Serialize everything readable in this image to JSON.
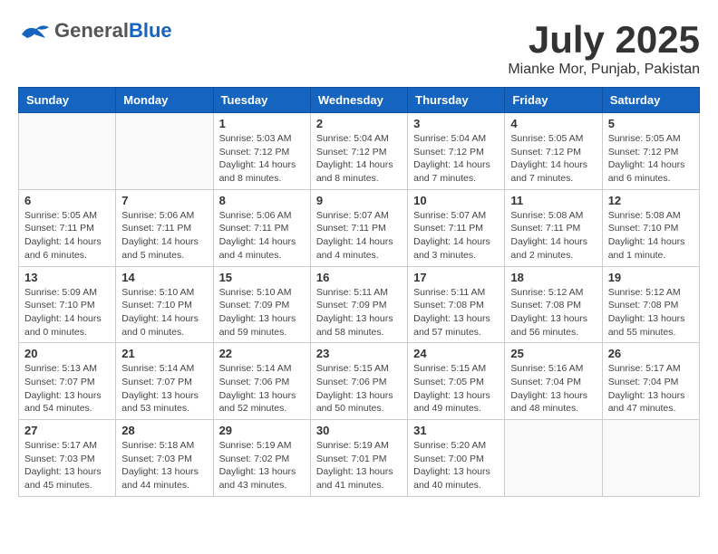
{
  "header": {
    "logo_general": "General",
    "logo_blue": "Blue",
    "month_title": "July 2025",
    "subtitle": "Mianke Mor, Punjab, Pakistan"
  },
  "weekdays": [
    "Sunday",
    "Monday",
    "Tuesday",
    "Wednesday",
    "Thursday",
    "Friday",
    "Saturday"
  ],
  "weeks": [
    [
      {
        "day": "",
        "info": ""
      },
      {
        "day": "",
        "info": ""
      },
      {
        "day": "1",
        "info": "Sunrise: 5:03 AM\nSunset: 7:12 PM\nDaylight: 14 hours and 8 minutes."
      },
      {
        "day": "2",
        "info": "Sunrise: 5:04 AM\nSunset: 7:12 PM\nDaylight: 14 hours and 8 minutes."
      },
      {
        "day": "3",
        "info": "Sunrise: 5:04 AM\nSunset: 7:12 PM\nDaylight: 14 hours and 7 minutes."
      },
      {
        "day": "4",
        "info": "Sunrise: 5:05 AM\nSunset: 7:12 PM\nDaylight: 14 hours and 7 minutes."
      },
      {
        "day": "5",
        "info": "Sunrise: 5:05 AM\nSunset: 7:12 PM\nDaylight: 14 hours and 6 minutes."
      }
    ],
    [
      {
        "day": "6",
        "info": "Sunrise: 5:05 AM\nSunset: 7:11 PM\nDaylight: 14 hours and 6 minutes."
      },
      {
        "day": "7",
        "info": "Sunrise: 5:06 AM\nSunset: 7:11 PM\nDaylight: 14 hours and 5 minutes."
      },
      {
        "day": "8",
        "info": "Sunrise: 5:06 AM\nSunset: 7:11 PM\nDaylight: 14 hours and 4 minutes."
      },
      {
        "day": "9",
        "info": "Sunrise: 5:07 AM\nSunset: 7:11 PM\nDaylight: 14 hours and 4 minutes."
      },
      {
        "day": "10",
        "info": "Sunrise: 5:07 AM\nSunset: 7:11 PM\nDaylight: 14 hours and 3 minutes."
      },
      {
        "day": "11",
        "info": "Sunrise: 5:08 AM\nSunset: 7:11 PM\nDaylight: 14 hours and 2 minutes."
      },
      {
        "day": "12",
        "info": "Sunrise: 5:08 AM\nSunset: 7:10 PM\nDaylight: 14 hours and 1 minute."
      }
    ],
    [
      {
        "day": "13",
        "info": "Sunrise: 5:09 AM\nSunset: 7:10 PM\nDaylight: 14 hours and 0 minutes."
      },
      {
        "day": "14",
        "info": "Sunrise: 5:10 AM\nSunset: 7:10 PM\nDaylight: 14 hours and 0 minutes."
      },
      {
        "day": "15",
        "info": "Sunrise: 5:10 AM\nSunset: 7:09 PM\nDaylight: 13 hours and 59 minutes."
      },
      {
        "day": "16",
        "info": "Sunrise: 5:11 AM\nSunset: 7:09 PM\nDaylight: 13 hours and 58 minutes."
      },
      {
        "day": "17",
        "info": "Sunrise: 5:11 AM\nSunset: 7:08 PM\nDaylight: 13 hours and 57 minutes."
      },
      {
        "day": "18",
        "info": "Sunrise: 5:12 AM\nSunset: 7:08 PM\nDaylight: 13 hours and 56 minutes."
      },
      {
        "day": "19",
        "info": "Sunrise: 5:12 AM\nSunset: 7:08 PM\nDaylight: 13 hours and 55 minutes."
      }
    ],
    [
      {
        "day": "20",
        "info": "Sunrise: 5:13 AM\nSunset: 7:07 PM\nDaylight: 13 hours and 54 minutes."
      },
      {
        "day": "21",
        "info": "Sunrise: 5:14 AM\nSunset: 7:07 PM\nDaylight: 13 hours and 53 minutes."
      },
      {
        "day": "22",
        "info": "Sunrise: 5:14 AM\nSunset: 7:06 PM\nDaylight: 13 hours and 52 minutes."
      },
      {
        "day": "23",
        "info": "Sunrise: 5:15 AM\nSunset: 7:06 PM\nDaylight: 13 hours and 50 minutes."
      },
      {
        "day": "24",
        "info": "Sunrise: 5:15 AM\nSunset: 7:05 PM\nDaylight: 13 hours and 49 minutes."
      },
      {
        "day": "25",
        "info": "Sunrise: 5:16 AM\nSunset: 7:04 PM\nDaylight: 13 hours and 48 minutes."
      },
      {
        "day": "26",
        "info": "Sunrise: 5:17 AM\nSunset: 7:04 PM\nDaylight: 13 hours and 47 minutes."
      }
    ],
    [
      {
        "day": "27",
        "info": "Sunrise: 5:17 AM\nSunset: 7:03 PM\nDaylight: 13 hours and 45 minutes."
      },
      {
        "day": "28",
        "info": "Sunrise: 5:18 AM\nSunset: 7:03 PM\nDaylight: 13 hours and 44 minutes."
      },
      {
        "day": "29",
        "info": "Sunrise: 5:19 AM\nSunset: 7:02 PM\nDaylight: 13 hours and 43 minutes."
      },
      {
        "day": "30",
        "info": "Sunrise: 5:19 AM\nSunset: 7:01 PM\nDaylight: 13 hours and 41 minutes."
      },
      {
        "day": "31",
        "info": "Sunrise: 5:20 AM\nSunset: 7:00 PM\nDaylight: 13 hours and 40 minutes."
      },
      {
        "day": "",
        "info": ""
      },
      {
        "day": "",
        "info": ""
      }
    ]
  ]
}
